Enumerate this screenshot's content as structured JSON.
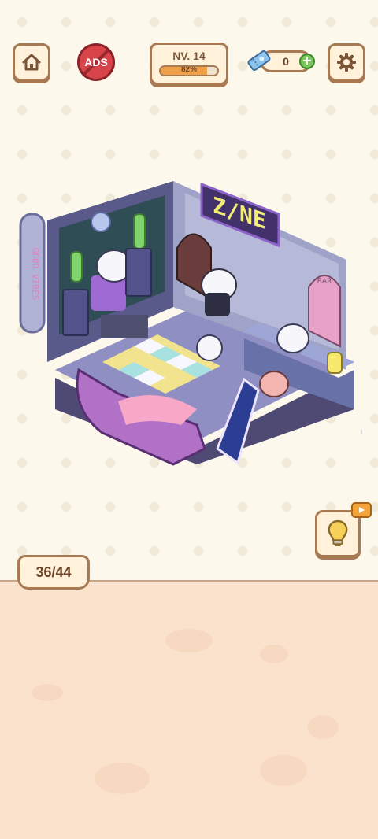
{
  "header": {
    "home_icon": "house-icon",
    "ads_label": "ADS",
    "level_label": "NV. 14",
    "level_progress_text": "82%",
    "level_progress": 0.82,
    "tickets_count": "0",
    "ticket_icon": "ticket-icon",
    "add_icon": "plus-icon",
    "settings_icon": "gear-icon"
  },
  "scene": {
    "neon_sign": "Z/NE",
    "side_sign": "GOOD VIBES",
    "bar_sign": "BAR"
  },
  "hint": {
    "icon": "lightbulb-icon",
    "badge_icon": "video-play-icon"
  },
  "progress": {
    "label": "36/44"
  },
  "colors": {
    "accent": "#a77a54",
    "panel_bg": "#fff1da",
    "bottom_bg": "#fbe2cd",
    "ads_red": "#d9434a"
  }
}
